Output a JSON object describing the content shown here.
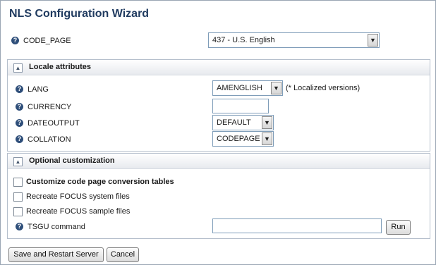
{
  "title": "NLS Configuration Wizard",
  "code_page": {
    "label": "CODE_PAGE",
    "value": "437 - U.S. English"
  },
  "locale_section": {
    "title": "Locale attributes",
    "lang": {
      "label": "LANG",
      "value": "AMENGLISH",
      "note": "(* Localized versions)"
    },
    "currency": {
      "label": "CURRENCY",
      "value": ""
    },
    "dateoutput": {
      "label": "DATEOUTPUT",
      "value": "DEFAULT"
    },
    "collation": {
      "label": "COLLATION",
      "value": "CODEPAGE"
    }
  },
  "optional_section": {
    "title": "Optional customization",
    "customize_label": "Customize code page conversion tables",
    "recreate_system_label": "Recreate FOCUS system files",
    "recreate_sample_label": "Recreate FOCUS sample files",
    "tsgu": {
      "label": "TSGU command",
      "value": "",
      "run_label": "Run"
    }
  },
  "footer": {
    "save_label": "Save and Restart Server",
    "cancel_label": "Cancel"
  },
  "icons": {
    "help": "help-icon",
    "collapse": "collapse-icon",
    "dropdown": "chevron-down-icon"
  }
}
